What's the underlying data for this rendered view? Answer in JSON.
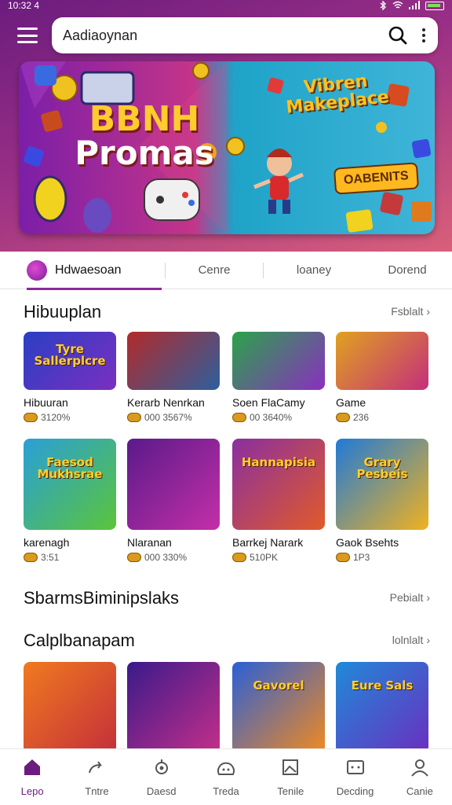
{
  "status_bar": {
    "time": "10:32 4"
  },
  "search": {
    "value": "Aadiaoynan"
  },
  "banner": {
    "left_title_line1": "BBNH",
    "left_title_line2": "Promas",
    "right_title_line1": "Vibren",
    "right_title_line2": "Makeplace",
    "right_badge": "OABENITS"
  },
  "tabs": [
    {
      "label": "Hdwaesoan"
    },
    {
      "label": "Cenre"
    },
    {
      "label": "loaney"
    },
    {
      "label": "Dorend"
    }
  ],
  "sections": [
    {
      "title": "Hibuuplan",
      "see_all": "Fsblalt"
    },
    {
      "title": "SbarmsBiminipslaks",
      "see_all": "Pebialt"
    },
    {
      "title": "Calplbanapam",
      "see_all": "lolnlalt"
    }
  ],
  "row1": [
    {
      "name": "Hibuuran",
      "meta": "3120%",
      "thumb_text": "Tyre Sallerplcre",
      "colors": [
        "#2a3fc4",
        "#7a2fc0"
      ]
    },
    {
      "name": "Kerarb Nenrkan",
      "meta": "000 3567%",
      "thumb_text": "",
      "colors": [
        "#b22a2a",
        "#2d5f9e"
      ]
    },
    {
      "name": "Soen FlaCamy",
      "meta": "00 3640%",
      "thumb_text": "",
      "colors": [
        "#2aa34a",
        "#8a2fc0"
      ]
    },
    {
      "name": "Game",
      "meta": "236",
      "thumb_text": "",
      "colors": [
        "#e0a21f",
        "#c42f7a"
      ]
    }
  ],
  "row2": [
    {
      "name": "karenagh",
      "meta": "3:51",
      "thumb_text": "Faesod Mukhsrae",
      "colors": [
        "#2a9fd8",
        "#5ac43a"
      ]
    },
    {
      "name": "Nlaranan",
      "meta": "000 330%",
      "thumb_text": "",
      "colors": [
        "#5a1a8a",
        "#c42fa8"
      ]
    },
    {
      "name": "Barrkej Narark",
      "meta": "510PK",
      "thumb_text": "Hannapisia",
      "colors": [
        "#8a2fa0",
        "#e05a2a"
      ]
    },
    {
      "name": "Gaok Bsehts",
      "meta": "1P3",
      "thumb_text": "Grary Pesbeis",
      "colors": [
        "#1f7ad8",
        "#f0b21f"
      ]
    }
  ],
  "row3": [
    {
      "colors": [
        "#f07a1f",
        "#c42f3a"
      ],
      "thumb_text": ""
    },
    {
      "colors": [
        "#3a1a8a",
        "#c42f8a"
      ],
      "thumb_text": ""
    },
    {
      "colors": [
        "#2a5fd8",
        "#f08a1f"
      ],
      "thumb_text": "Gavorel"
    },
    {
      "colors": [
        "#1f8ad8",
        "#6a2fc0"
      ],
      "thumb_text": "Eure Sals"
    }
  ],
  "bottom_nav": [
    {
      "label": "Lepo",
      "icon": "home-icon"
    },
    {
      "label": "Tntre",
      "icon": "share-icon"
    },
    {
      "label": "Daesd",
      "icon": "settings-icon"
    },
    {
      "label": "Treda",
      "icon": "chart-icon"
    },
    {
      "label": "Tenile",
      "icon": "image-icon"
    },
    {
      "label": "Decding",
      "icon": "gamepad-icon"
    },
    {
      "label": "Canie",
      "icon": "person-icon"
    }
  ],
  "colors": {
    "accent": "#6b1c7e",
    "tab_indicator": "#8a2a9a"
  }
}
